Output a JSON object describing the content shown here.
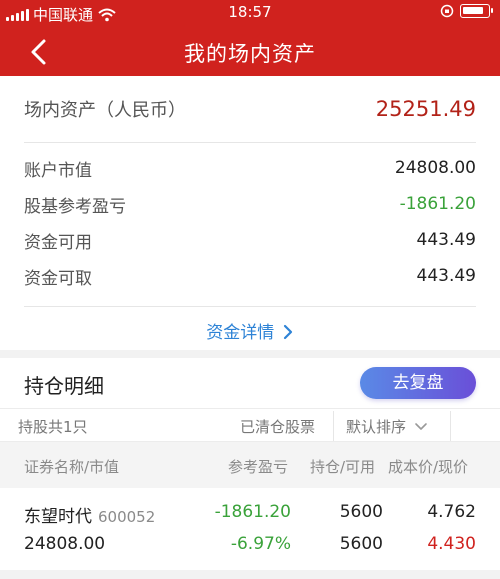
{
  "status_bar": {
    "carrier": "中国联通",
    "time": "18:57"
  },
  "header": {
    "title": "我的场内资产"
  },
  "summary": {
    "total_label": "场内资产（人民币）",
    "total_value": "25251.49",
    "rows": [
      {
        "label": "账户市值",
        "value": "24808.00"
      },
      {
        "label": "股基参考盈亏",
        "value": "-1861.20"
      },
      {
        "label": "资金可用",
        "value": "443.49"
      },
      {
        "label": "资金可取",
        "value": "443.49"
      }
    ],
    "detail_link": "资金详情"
  },
  "holdings": {
    "title": "持仓明细",
    "review_button": "去复盘",
    "count": "持股共1只",
    "cleared": "已清仓股票",
    "sort": "默认排序",
    "columns": {
      "name_value": "证券名称/市值",
      "pnl": "参考盈亏",
      "position": "持仓/可用",
      "price": "成本价/现价"
    },
    "rows": [
      {
        "name": "东望时代",
        "code": "600052",
        "market_value": "24808.00",
        "pnl": "-1861.20",
        "pnl_pct": "-6.97%",
        "position": "5600",
        "available": "5600",
        "cost_price": "4.762",
        "current_price": "4.430"
      }
    ]
  },
  "colors": {
    "header_red": "#d0221e",
    "loss_green": "#3aa23a",
    "link_blue": "#2e83d6"
  },
  "icons": [
    "back-arrow-icon",
    "wifi-icon",
    "lock-rotation-icon",
    "battery-icon",
    "chevron-right-icon",
    "chevron-down-icon"
  ]
}
